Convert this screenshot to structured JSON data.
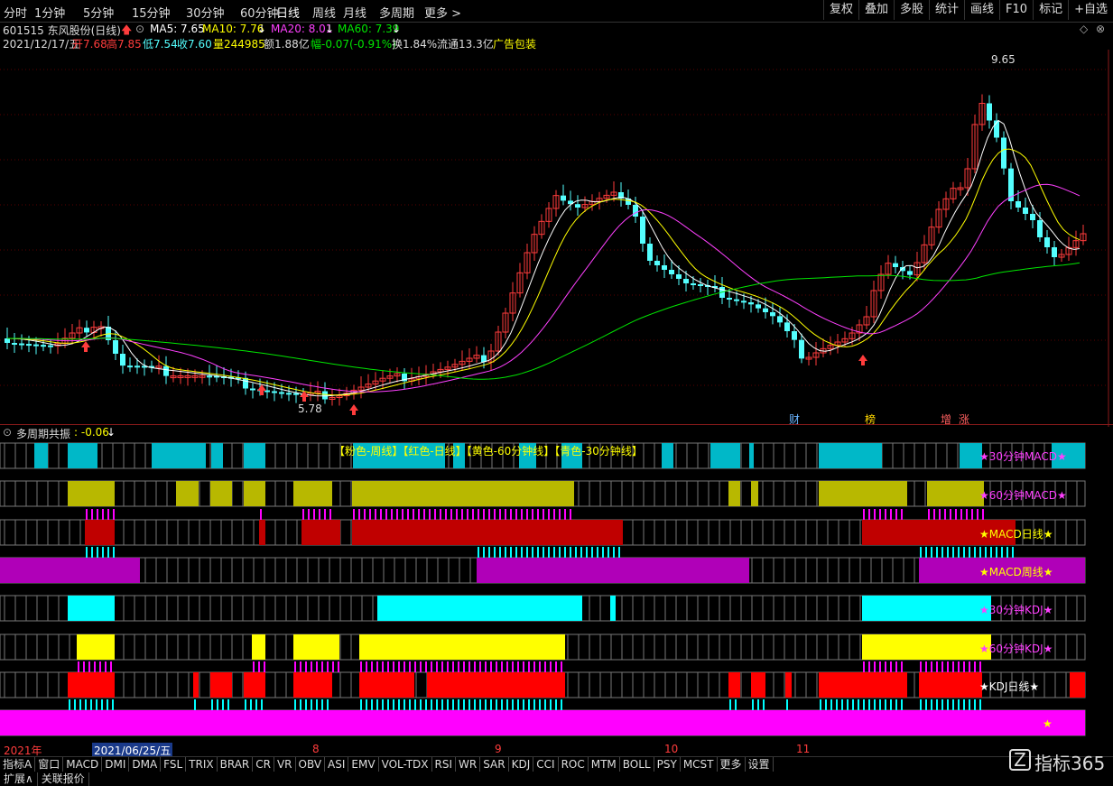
{
  "toolbar": {
    "periods": [
      "分时",
      "1分钟",
      "5分钟",
      "15分钟",
      "30分钟",
      "60分钟",
      "日线",
      "周线",
      "月线",
      "多周期",
      "更多"
    ],
    "active": "日线",
    "right_buttons": [
      "复权",
      "叠加",
      "多股",
      "统计",
      "画线",
      "F10",
      "标记",
      "+自选"
    ]
  },
  "stock": {
    "code_name": "601515 东风股份(日线)",
    "ma5": "MA5: 7.65",
    "ma10": "MA10: 7.76",
    "ma20": "MA20: 8.01",
    "ma60": "MA60: 7.39",
    "date": "2021/12/17/五",
    "open": "开7.68",
    "high": "高7.85",
    "low": "低7.54",
    "close": "收7.60",
    "volume": "量244985",
    "amount": "额1.88亿",
    "change": "幅-0.07(-0.91%)",
    "turnover": "换1.84%",
    "float_cap": "流通13.3亿",
    "industry": "广告包装"
  },
  "chart_labels": {
    "high_price": "9.65",
    "low_price": "5.78",
    "tags": [
      "财",
      "榜",
      "增",
      "涨"
    ]
  },
  "indicator": {
    "title": "多周期共振",
    "value": ": -0.06",
    "legend": "【粉色-周线】【红色-日线】【黄色-60分钟线】【青色-30分钟线】",
    "rows": [
      "★30分钟MACD★",
      "★60分钟MACD★",
      "★MACD日线★",
      "★MACD周线★",
      "★30分钟KDJ★",
      "★60分钟KDJ★",
      "★KDJ日线★",
      "★"
    ]
  },
  "dates": {
    "year": "2021年",
    "highlight": "2021/06/25/五",
    "months": [
      "8",
      "9",
      "10",
      "11"
    ]
  },
  "bottom_tabs": [
    "指标A",
    "窗口",
    "MACD",
    "DMI",
    "DMA",
    "FSL",
    "TRIX",
    "BRAR",
    "CR",
    "VR",
    "OBV",
    "ASI",
    "EMV",
    "VOL-TDX",
    "RSI",
    "WR",
    "SAR",
    "KDJ",
    "CCI",
    "ROC",
    "MTM",
    "BOLL",
    "PSY",
    "MCST",
    "更多",
    "设置"
  ],
  "bottom_tabs2": [
    "扩展∧",
    "关联报价"
  ],
  "watermark": "指标365",
  "colors": {
    "up": "#ff3c3c",
    "down": "#54ffff",
    "ma5": "#ffffff",
    "ma10": "#ffff00",
    "ma20": "#ff40ff",
    "ma60": "#00e600",
    "cyan_band": "#00b8c8",
    "olive_band": "#b8b800",
    "red_band": "#c00000",
    "purple_band": "#b000b8",
    "bright_cyan": "#00ffff",
    "bright_yellow": "#ffff00",
    "bright_red": "#ff0000",
    "magenta": "#ff00ff"
  }
}
